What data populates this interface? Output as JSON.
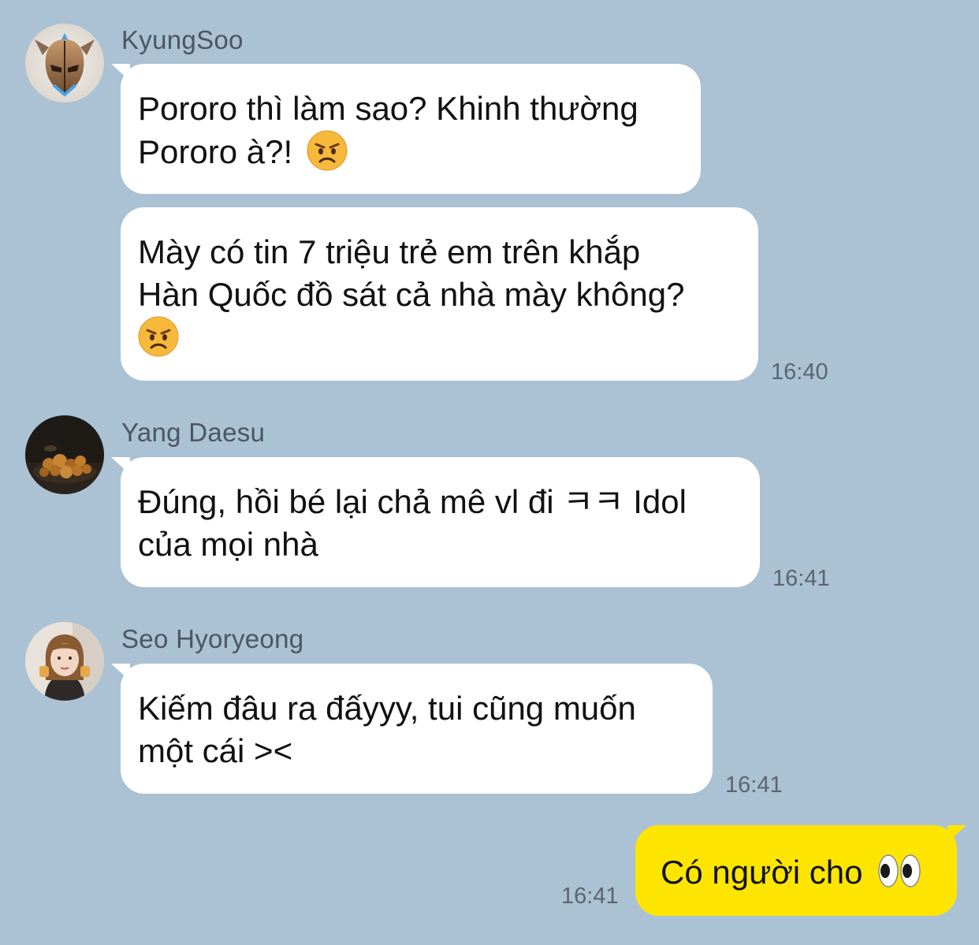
{
  "messages": [
    {
      "sender": "KyungSoo",
      "avatar_icon": "knight-helmet-avatar-icon",
      "bubbles": [
        {
          "lines": [
            "Pororo thì làm sao? Khinh thường",
            "Pororo à?!"
          ],
          "emoji": "angry-face-emoji"
        },
        {
          "lines": [
            "Mày có tin 7 triệu trẻ em trên khắp",
            "Hàn Quốc đồ sát cả nhà mày không?"
          ],
          "emoji": "angry-face-emoji",
          "time": "16:40"
        }
      ]
    },
    {
      "sender": "Yang Daesu",
      "avatar_icon": "fried-food-avatar-icon",
      "bubbles": [
        {
          "lines": [
            "Đúng, hồi bé lại chả mê vl đi ㅋㅋ Idol",
            "của mọi nhà"
          ],
          "time": "16:41"
        }
      ]
    },
    {
      "sender": "Seo Hyoryeong",
      "avatar_icon": "girl-photo-avatar-icon",
      "bubbles": [
        {
          "lines": [
            "Kiếm đâu ra đấyyy, tui cũng muốn",
            "một cái ><"
          ],
          "time": "16:41"
        }
      ]
    }
  ],
  "my_message": {
    "text": "Có người cho",
    "emoji": "eyes-emoji",
    "time": "16:41"
  },
  "colors": {
    "background": "#abc1d4",
    "incoming_bubble": "#ffffff",
    "outgoing_bubble": "#fee500"
  }
}
